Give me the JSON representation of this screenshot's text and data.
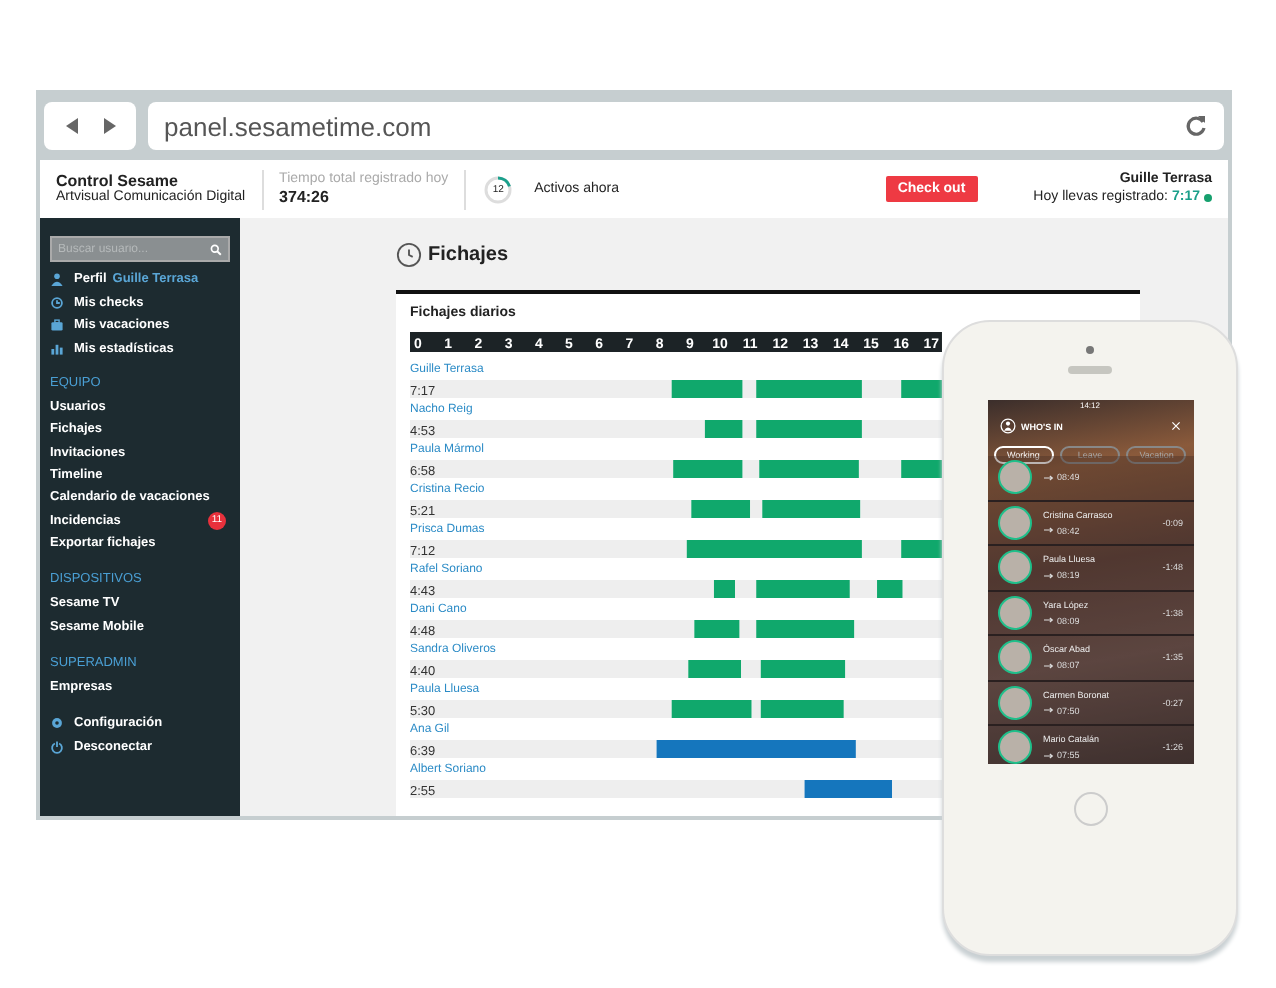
{
  "browser": {
    "url": "panel.sesametime.com"
  },
  "header": {
    "company": "Control Sesame",
    "subtitle": "Artvisual Comunicación Digital",
    "total_label": "Tiempo total registrado hoy",
    "total_value": "374:26",
    "active": {
      "count": "12",
      "level": 0.2,
      "label": "Activos ahora"
    },
    "checkout_button": "Check out",
    "user": "Guille Terrasa",
    "today_label": "Hoy llevas registrado:",
    "today_value": "7:17"
  },
  "sidebar": {
    "search_placeholder": "Buscar usuario...",
    "personal": [
      {
        "kind": "profile",
        "label": "Perfil",
        "user": "Guille Terrasa"
      },
      {
        "kind": "checks",
        "label": "Mis checks"
      },
      {
        "kind": "vacations",
        "label": "Mis vacaciones"
      },
      {
        "kind": "stats",
        "label": "Mis estadísticas"
      }
    ],
    "sections": [
      {
        "title": "EQUIPO",
        "items": [
          {
            "label": "Usuarios"
          },
          {
            "label": "Fichajes"
          },
          {
            "label": "Invitaciones"
          },
          {
            "label": "Timeline"
          },
          {
            "label": "Calendario de vacaciones"
          },
          {
            "label": "Incidencias",
            "badge": "11"
          },
          {
            "label": "Exportar fichajes"
          }
        ]
      },
      {
        "title": "DISPOSITIVOS",
        "items": [
          {
            "label": "Sesame TV"
          },
          {
            "label": "Sesame Mobile"
          }
        ]
      },
      {
        "title": "SUPERADMIN",
        "items": [
          {
            "label": "Empresas"
          }
        ]
      }
    ],
    "footer": [
      {
        "kind": "settings",
        "label": "Configuración"
      },
      {
        "kind": "logout",
        "label": "Desconectar"
      }
    ]
  },
  "page": {
    "title": "Fichajes",
    "card_title": "Fichajes diarios",
    "totals": [
      "7:17",
      "4:53",
      "6:58",
      "5:21",
      "7:12",
      "4:43",
      "4:48",
      "4:40",
      "5:30",
      "6:39",
      "2:55"
    ],
    "chart_data": {
      "type": "bar",
      "orientation": "horizontal",
      "xticks": [
        0,
        1,
        2,
        3,
        4,
        5,
        6,
        7,
        8,
        9,
        10,
        11,
        12,
        13,
        14,
        15,
        16,
        17
      ],
      "categories": [
        "Guille Terrasa",
        "Nacho Reig",
        "Paula Mármol",
        "Cristina Recio",
        "Prisca Dumas",
        "Rafel Soriano",
        "Dani Cano",
        "Sandra Oliveros",
        "Paula Lluesa",
        "Ana Gil",
        "Albert Soriano"
      ],
      "xlim": [
        0,
        17.35
      ],
      "stacked": true,
      "series": [
        {
          "color": "#eeeeee",
          "values": [
            8.4,
            9.5,
            8.45,
            9.05,
            8.9,
            9.8,
            9.15,
            8.95,
            8.4,
            7.9,
            12.8
          ]
        },
        {
          "color": "#10a86c",
          "values": [
            2.35,
            1.25,
            2.3,
            1.95,
            5.8,
            0.7,
            1.5,
            1.75,
            2.65,
            null,
            null
          ]
        },
        {
          "color": "#1576bd",
          "values": [
            null,
            null,
            null,
            null,
            null,
            null,
            null,
            null,
            null,
            6.6,
            2.9
          ]
        },
        {
          "color": "#eeeeee",
          "values": [
            0.45,
            0.45,
            0.55,
            0.4,
            1.3,
            0.7,
            0.55,
            0.65,
            0.3,
            null,
            null
          ]
        },
        {
          "color": "#10a86c",
          "values": [
            3.5,
            3.5,
            3.3,
            3.25,
            1.35,
            3.1,
            3.25,
            2.8,
            2.75,
            null,
            null
          ]
        },
        {
          "color": "#eeeeee",
          "values": [
            1.3,
            null,
            1.4,
            null,
            null,
            0.9,
            null,
            null,
            null,
            null,
            null
          ]
        },
        {
          "color": "#10a86c",
          "values": [
            1.35,
            null,
            1.35,
            null,
            null,
            0.85,
            null,
            null,
            null,
            null,
            null
          ]
        },
        {
          "color": "#eeeeee",
          "values": [
            null,
            2.65,
            null,
            2.7,
            null,
            1.3,
            2.9,
            3.2,
            3.25,
            2.85,
            1.65
          ]
        }
      ]
    }
  },
  "phone": {
    "clock": "14:12",
    "title": "WHO'S IN",
    "tabs": [
      {
        "label": "Working",
        "selected": true
      },
      {
        "label": "Leave",
        "selected": false
      },
      {
        "label": "Vacation",
        "selected": false
      }
    ],
    "people": [
      {
        "time": "08:49"
      },
      {
        "name": "Cristina Carrasco",
        "time": "08:42",
        "diff": "-0:09"
      },
      {
        "name": "Paula Lluesa",
        "time": "08:19",
        "diff": "-1:48"
      },
      {
        "name": "Yara López",
        "time": "08:09",
        "diff": "-1:38"
      },
      {
        "name": "Óscar Abad",
        "time": "08:07",
        "diff": "-1:35"
      },
      {
        "name": "Carmen Boronat",
        "time": "07:50",
        "diff": "-0:27"
      },
      {
        "name": "Mario Catalán",
        "time": "07:55",
        "diff": "-1:26"
      }
    ]
  }
}
